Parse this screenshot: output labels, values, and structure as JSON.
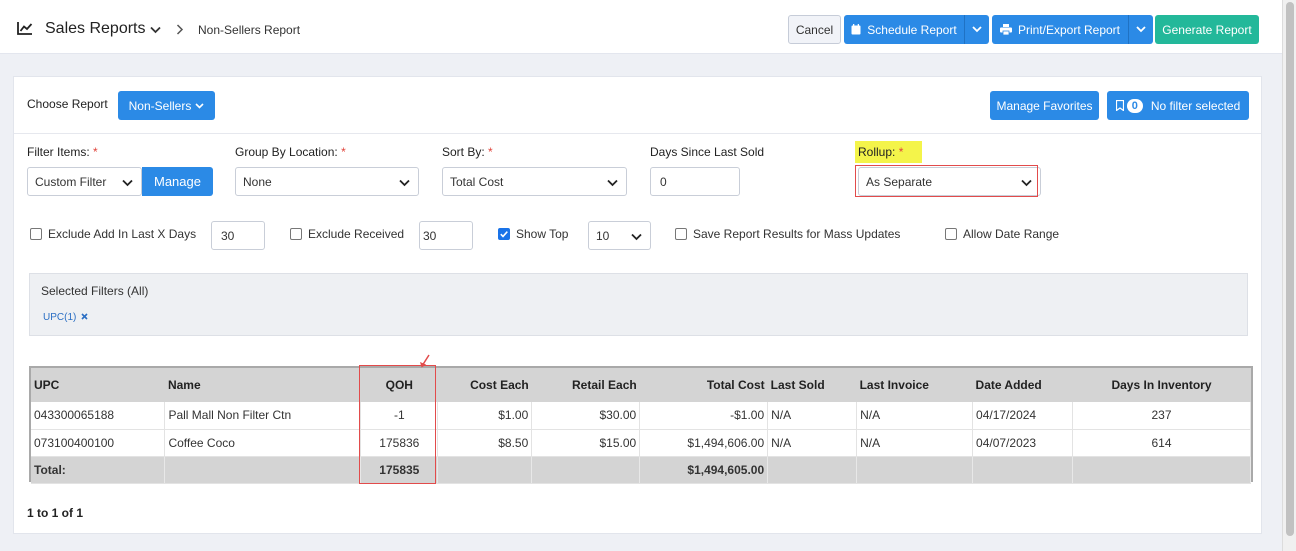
{
  "header": {
    "title": "Sales Reports",
    "breadcrumb": "Non-Sellers Report",
    "cancel_label": "Cancel",
    "schedule_label": "Schedule Report",
    "print_label": "Print/Export Report",
    "generate_label": "Generate Report"
  },
  "controls": {
    "choose_report_label": "Choose Report",
    "report_select": "Non-Sellers",
    "manage_favorites": "Manage Favorites",
    "filter_count": "0",
    "no_filter_label": "No filter selected",
    "filter_items_label": "Filter Items:",
    "filter_items_value": "Custom Filter",
    "manage_label": "Manage",
    "group_by_label": "Group By Location:",
    "group_by_value": "None",
    "sort_by_label": "Sort By:",
    "sort_by_value": "Total Cost",
    "days_since_label": "Days Since Last Sold",
    "days_since_value": "0",
    "rollup_label": "Rollup:",
    "rollup_value": "As Separate",
    "required_mark": "*"
  },
  "options": {
    "exclude_add_label": "Exclude Add In Last X Days",
    "exclude_add_value": "30",
    "exclude_received_label": "Exclude Received",
    "exclude_received_value": "30",
    "show_top_label": "Show Top",
    "show_top_value": "10",
    "save_results_label": "Save Report Results for Mass Updates",
    "allow_date_label": "Allow Date Range",
    "show_top_checked": true
  },
  "selected_filters": {
    "title": "Selected Filters (All)",
    "chip": "UPC(1)"
  },
  "table": {
    "headers": [
      "UPC",
      "Name",
      "QOH",
      "Cost Each",
      "Retail Each",
      "Total Cost",
      "Last Sold",
      "Last Invoice",
      "Date Added",
      "Days In Inventory"
    ],
    "rows": [
      [
        "043300065188",
        "Pall Mall Non Filter Ctn",
        "-1",
        "$1.00",
        "$30.00",
        "-$1.00",
        "N/A",
        "N/A",
        "04/17/2024",
        "237"
      ],
      [
        "073100400100",
        "Coffee Coco",
        "175836",
        "$8.50",
        "$15.00",
        "$1,494,606.00",
        "N/A",
        "N/A",
        "04/07/2023",
        "614"
      ]
    ],
    "total": {
      "label": "Total:",
      "qoh": "175835",
      "total_cost": "$1,494,605.00"
    }
  },
  "pagination": "1 to 1 of 1",
  "colors": {
    "primary": "#2b8ae6",
    "accent": "#23b89a",
    "highlight": "#f4f44a",
    "annotation": "#e24b4b"
  }
}
